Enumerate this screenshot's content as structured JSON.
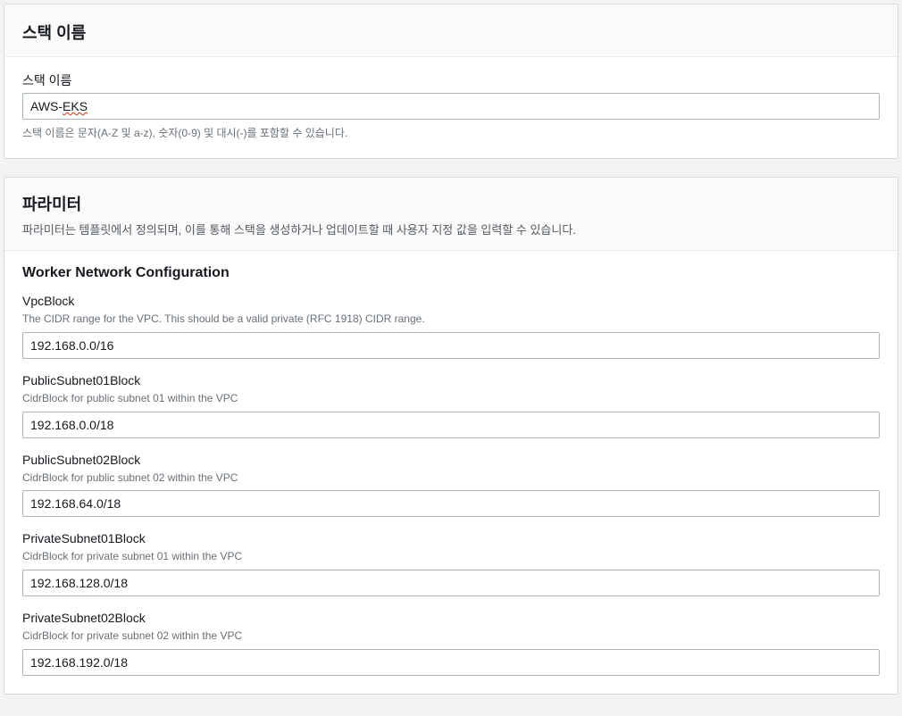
{
  "stackName": {
    "panelTitle": "스택 이름",
    "fieldLabel": "스택 이름",
    "valuePrefix": "AWS-",
    "valueUnderlined": "EKS",
    "helpText": "스택 이름은 문자(A-Z 및 a-z), 숫자(0-9) 및 대시(-)를 포함할 수 있습니다."
  },
  "parameters": {
    "panelTitle": "파라미터",
    "panelSubtitle": "파라미터는 템플릿에서 정의되며, 이를 통해 스택을 생성하거나 업데이트할 때 사용자 지정 값을 입력할 수 있습니다.",
    "sectionTitle": "Worker Network Configuration",
    "fields": {
      "vpcBlock": {
        "label": "VpcBlock",
        "desc": "The CIDR range for the VPC. This should be a valid private (RFC 1918) CIDR range.",
        "value": "192.168.0.0/16"
      },
      "publicSubnet01": {
        "label": "PublicSubnet01Block",
        "desc": "CidrBlock for public subnet 01 within the VPC",
        "value": "192.168.0.0/18"
      },
      "publicSubnet02": {
        "label": "PublicSubnet02Block",
        "desc": "CidrBlock for public subnet 02 within the VPC",
        "value": "192.168.64.0/18"
      },
      "privateSubnet01": {
        "label": "PrivateSubnet01Block",
        "desc": "CidrBlock for private subnet 01 within the VPC",
        "value": "192.168.128.0/18"
      },
      "privateSubnet02": {
        "label": "PrivateSubnet02Block",
        "desc": "CidrBlock for private subnet 02 within the VPC",
        "value": "192.168.192.0/18"
      }
    }
  }
}
